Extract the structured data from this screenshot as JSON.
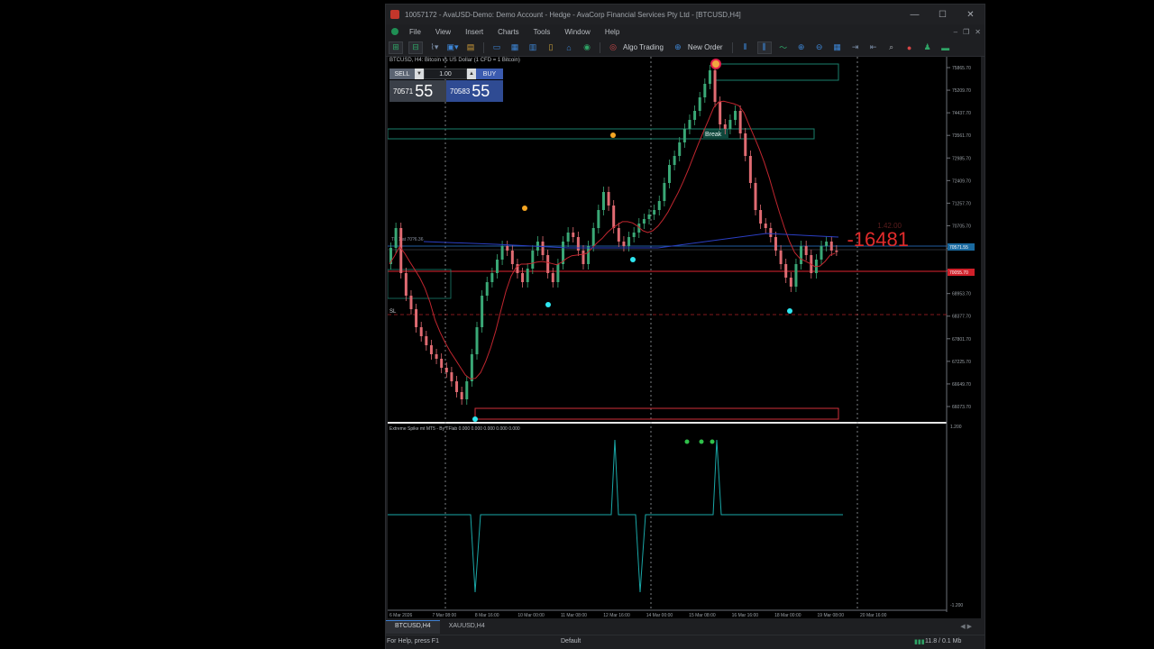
{
  "window": {
    "title": "10057172 - AvaUSD-Demo: Demo Account - Hedge - AvaCorp Financial Services Pty Ltd - [BTCUSD,H4]",
    "controls": {
      "minimize": "—",
      "maximize": "☐",
      "close": "✕"
    }
  },
  "menu": {
    "items": [
      "File",
      "View",
      "Insert",
      "Charts",
      "Tools",
      "Window",
      "Help"
    ],
    "doc_controls": [
      "–",
      "❐",
      "✕"
    ]
  },
  "toolbar": {
    "algo_trading": "Algo Trading",
    "new_order": "New Order"
  },
  "chart": {
    "header": "BTCUSD, H4:  Bitcoin vs US Dollar (1 CFD = 1 Bitcoin)",
    "symbol": "BTCUSD",
    "timeframe": "H4",
    "one_click": {
      "sell": "SELL",
      "buy": "BUY",
      "volume": "1.00",
      "bid_small": "70571",
      "bid_big": "55",
      "ask_small": "70583",
      "ask_big": "55"
    },
    "price_axis": [
      "75865.70",
      "75209.70",
      "74437.70",
      "73561.70",
      "72985.70",
      "72409.70",
      "71257.70",
      "70705.70",
      "70105.70",
      "69529.70",
      "68953.70",
      "68377.70",
      "67801.70",
      "67225.70",
      "66649.70",
      "66073.70"
    ],
    "current_price_labels": {
      "bid": "70571.55",
      "ask": "70055.70"
    },
    "time_axis": [
      "6 Mar 2026",
      "7 Mar 08:00",
      "8 Mar 16:00",
      "10 Mar 00:00",
      "11 Mar 08:00",
      "12 Mar 16:00",
      "14 Mar 00:00",
      "15 Mar 08:00",
      "16 Mar 16:00",
      "18 Mar 00:00",
      "19 Mar 08:00",
      "20 Mar 16:00"
    ],
    "tp_label": "TP 1 at 70?6.36",
    "sl_label": "SL",
    "break_label": "Break",
    "profit": "-16481",
    "profit_small": "1.42.00",
    "colors": {
      "bull": "#3aa876",
      "bear": "#e06b72",
      "ma": "#c0262f",
      "indicator": "#1aa7a7",
      "dot_orange": "#f5a623",
      "dot_cyan": "#2ee6f0"
    }
  },
  "indicator": {
    "title": "Extreme Spike mt MT5 - By TFlab  0.000  0.000  0.000  0.000  0.000",
    "scale_top": "1.200",
    "scale_bottom": "-1.200"
  },
  "tabs": [
    {
      "label": "BTCUSD,H4",
      "active": true
    },
    {
      "label": "XAUUSD,H4",
      "active": false
    }
  ],
  "status": {
    "help": "For Help, press F1",
    "profile": "Default",
    "traffic": "11.8 / 0.1 Mb"
  }
}
